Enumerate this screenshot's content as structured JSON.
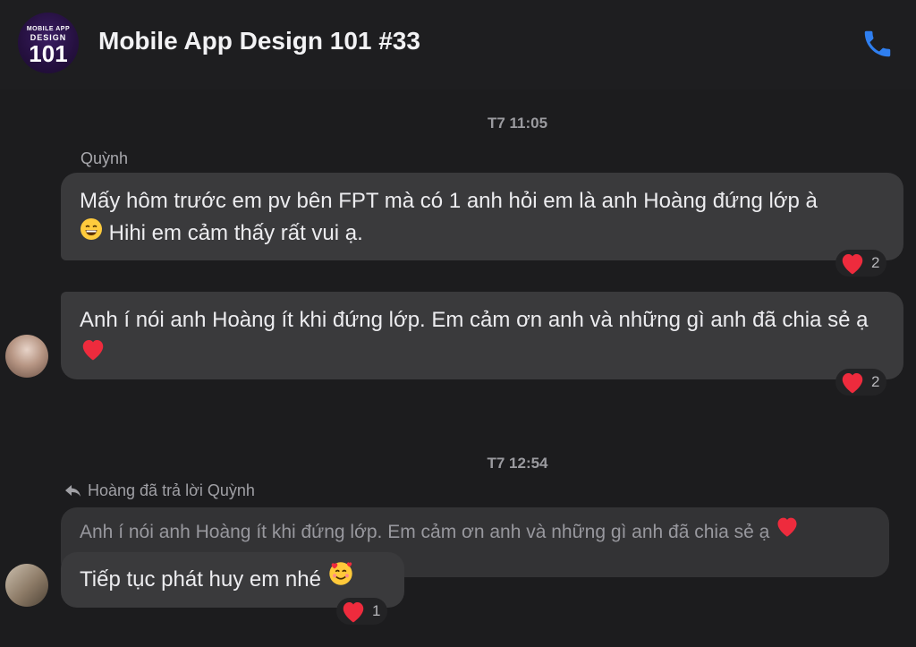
{
  "header": {
    "title": "Mobile App Design 101 #33",
    "avatar_text": {
      "line1": "MOBILE APP",
      "line2": "DESIGN",
      "line3": "101"
    },
    "call_icon": "phone-icon",
    "accent_color": "#2f7ff0"
  },
  "messages_group_1": {
    "timestamp": "T7 11:05",
    "sender": "Quỳnh",
    "msg1": {
      "part1": "Mấy hôm trước em pv bên FPT mà có 1 anh hỏi em là anh Hoàng đứng lớp à",
      "part2": "Hihi em cảm thấy rất vui ạ.",
      "reaction_count": "2"
    },
    "msg2": {
      "text": "Anh í nói anh Hoàng ít khi đứng lớp. Em cảm ơn anh và những gì anh đã chia sẻ ạ",
      "reaction_count": "2"
    }
  },
  "messages_group_2": {
    "timestamp": "T7 12:54",
    "reply_note": "Hoàng đã trả lời Quỳnh",
    "quoted": "Anh í nói anh Hoàng ít khi đứng lớp. Em cảm ơn anh và những gì anh đã chia sẻ ạ",
    "reply": "Tiếp tục phát huy em nhé",
    "reaction_count": "1"
  }
}
